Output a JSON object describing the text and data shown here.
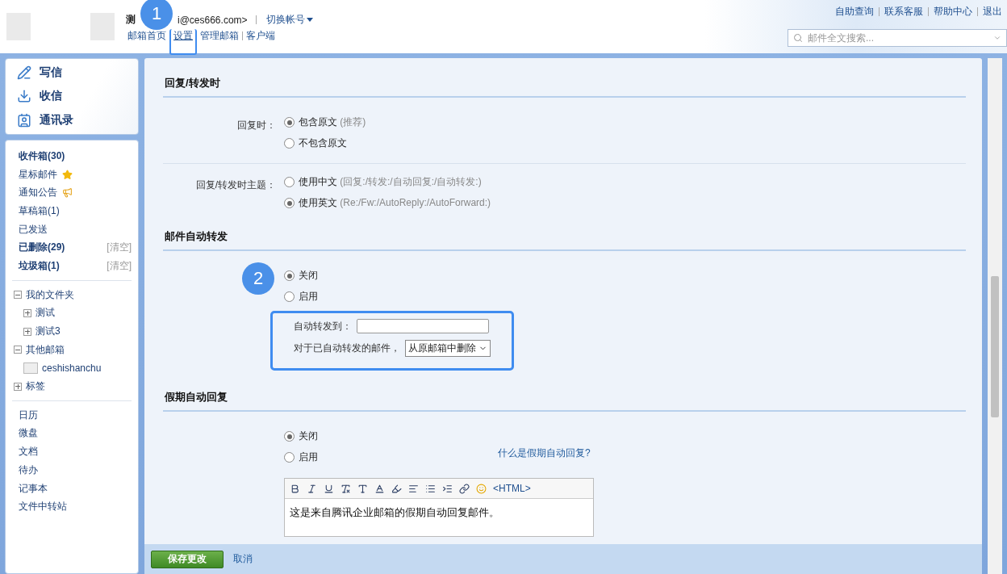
{
  "header": {
    "account_name": "测",
    "account_email": "i@ces666.com>",
    "switch_account": "切换帐号",
    "nav": [
      {
        "label": "邮箱首页",
        "selected": false
      },
      {
        "label": "设置",
        "selected": true
      },
      {
        "label": "管理邮箱",
        "selected": false
      },
      {
        "label": "客户端",
        "selected": false
      }
    ],
    "top_links": [
      "自助查询",
      "联系客服",
      "帮助中心",
      "退出"
    ],
    "search": {
      "placeholder": "邮件全文搜索..."
    }
  },
  "annotations": [
    {
      "label": "1"
    },
    {
      "label": "2"
    }
  ],
  "sidebar": {
    "actions": [
      {
        "kind": "compose",
        "label": "写信"
      },
      {
        "kind": "receive",
        "label": "收信"
      },
      {
        "kind": "contacts",
        "label": "通讯录"
      }
    ],
    "folders": [
      {
        "label": "收件箱(30)",
        "bold": true
      },
      {
        "label": "星标邮件",
        "bold": false,
        "kind": "star"
      },
      {
        "label": "通知公告",
        "bold": false,
        "kind": "notice"
      },
      {
        "label": "草稿箱(1)",
        "bold": false
      },
      {
        "label": "已发送",
        "bold": false
      },
      {
        "label": "已删除(29)",
        "bold": true,
        "action": "[清空]"
      },
      {
        "label": "垃圾箱(1)",
        "bold": true,
        "action": "[清空]"
      }
    ],
    "tree": [
      {
        "label": "我的文件夹",
        "expanded": true,
        "children": [
          {
            "label": "测试",
            "expanded": false
          },
          {
            "label": "测试3",
            "expanded": false
          }
        ]
      },
      {
        "label": "其他邮箱",
        "expanded": true,
        "children": [
          {
            "label": "ceshishanchu",
            "kind": "account"
          }
        ]
      },
      {
        "label": "标签",
        "expanded": false
      }
    ],
    "apps": [
      "日历",
      "微盘",
      "文档",
      "待办",
      "记事本",
      "文件中转站"
    ]
  },
  "settings": {
    "sections": [
      {
        "title": "回复/转发时",
        "groups": [
          {
            "label": "回复时：",
            "options": [
              {
                "label": "包含原文",
                "hint": "(推荐)",
                "selected": true
              },
              {
                "label": "不包含原文",
                "selected": false
              }
            ]
          },
          {
            "label": "回复/转发时主题：",
            "options": [
              {
                "label": "使用中文",
                "hint": "(回复:/转发:/自动回复:/自动转发:)",
                "selected": false
              },
              {
                "label": "使用英文",
                "hint": "(Re:/Fw:/AutoReply:/AutoForward:)",
                "selected": true
              }
            ]
          }
        ]
      },
      {
        "title": "邮件自动转发",
        "groups": [
          {
            "options": [
              {
                "label": "关闭",
                "selected": true
              },
              {
                "label": "启用",
                "selected": false
              }
            ],
            "forward": {
              "to_label": "自动转发到：",
              "after_label": "对于已自动转发的邮件，",
              "after_value": "从原邮箱中删除"
            }
          }
        ]
      },
      {
        "title": "假期自动回复",
        "groups": [
          {
            "options": [
              {
                "label": "关闭",
                "selected": true
              },
              {
                "label": "启用",
                "selected": false
              }
            ],
            "help_link": "什么是假期自动回复?",
            "editor": {
              "html_toggle": "<HTML>",
              "body": "这是来自腾讯企业邮箱的假期自动回复邮件。"
            }
          }
        ]
      }
    ]
  },
  "footer": {
    "save": "保存更改",
    "cancel": "取消"
  }
}
